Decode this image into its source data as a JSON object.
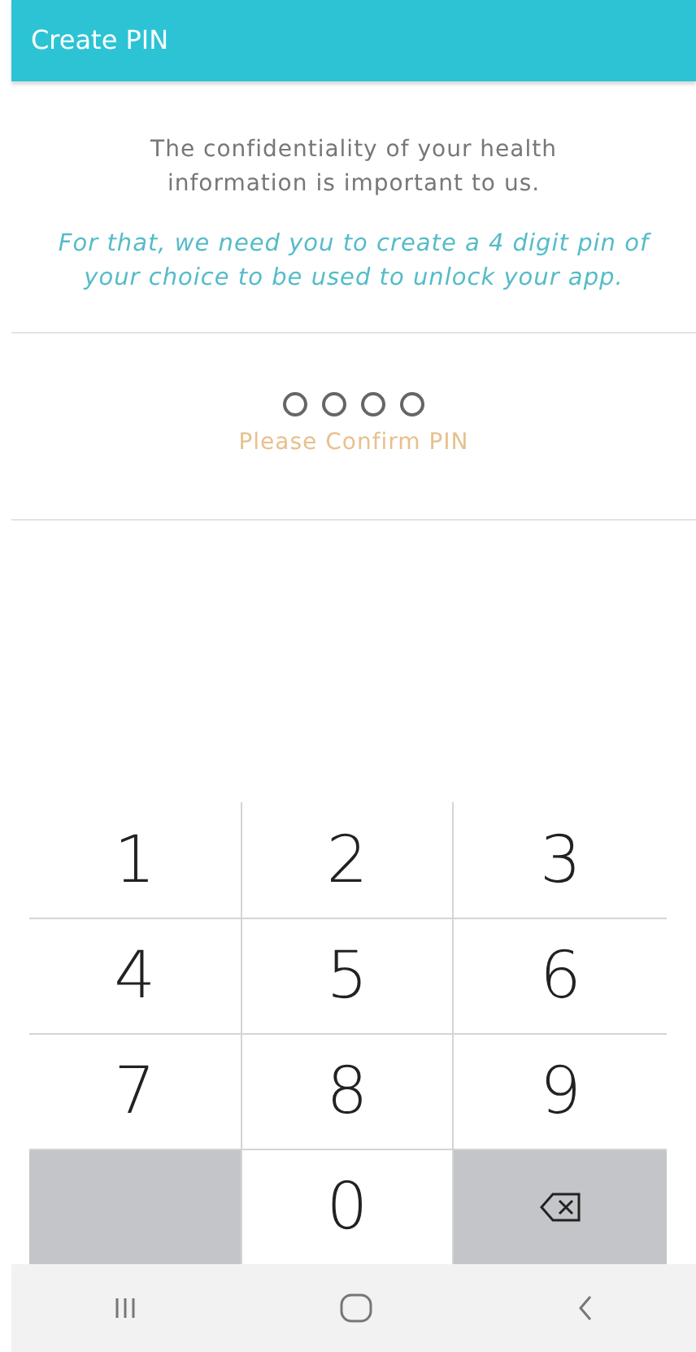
{
  "header": {
    "title": "Create PIN"
  },
  "intro": "The confidentiality of your health information is important to us.",
  "instruction": "For that, we need you to create a 4 digit pin of your choice to be used to unlock your app.",
  "pin_dots": [
    {
      "filled": false
    },
    {
      "filled": false
    },
    {
      "filled": false
    },
    {
      "filled": false
    }
  ],
  "prompt": "Please Confirm PIN",
  "keypad": [
    {
      "kind": "digit",
      "label": "1"
    },
    {
      "kind": "digit",
      "label": "2"
    },
    {
      "kind": "digit",
      "label": "3"
    },
    {
      "kind": "digit",
      "label": "4"
    },
    {
      "kind": "digit",
      "label": "5"
    },
    {
      "kind": "digit",
      "label": "6"
    },
    {
      "kind": "digit",
      "label": "7"
    },
    {
      "kind": "digit",
      "label": "8"
    },
    {
      "kind": "digit",
      "label": "9"
    },
    {
      "kind": "blank"
    },
    {
      "kind": "digit",
      "label": "0"
    },
    {
      "kind": "backspace"
    }
  ]
}
